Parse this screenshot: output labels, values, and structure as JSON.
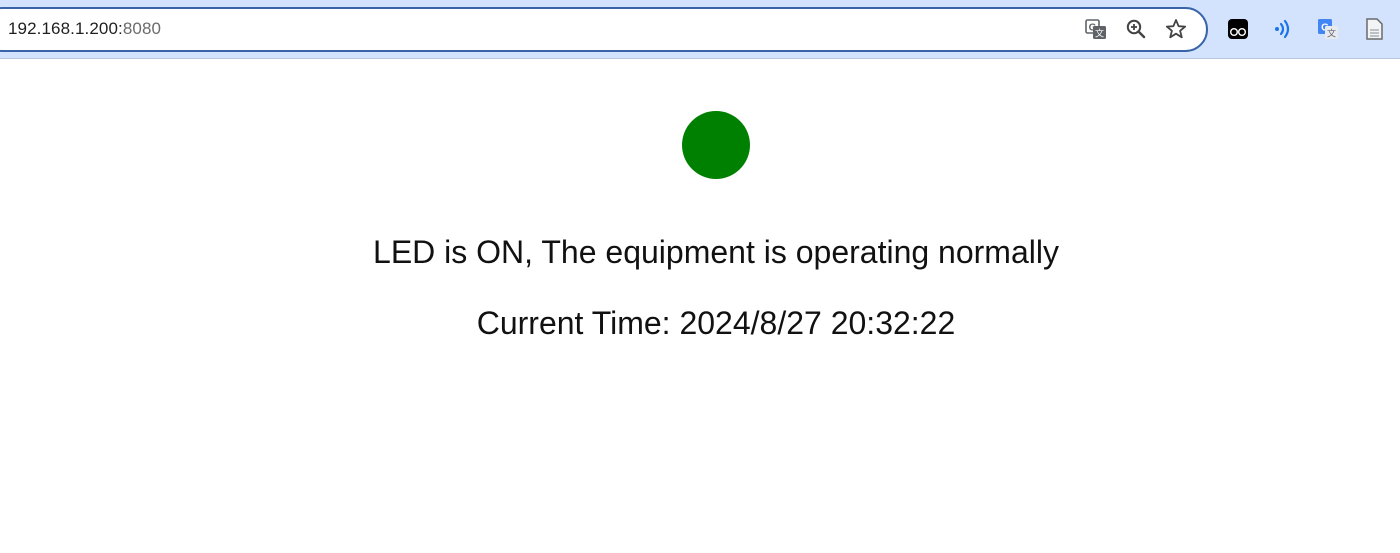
{
  "browser": {
    "address_host": "192.168.1.200:",
    "address_port": "8080",
    "omnibox_icons": [
      "translate-icon",
      "zoom-icon",
      "bookmark-star-icon"
    ],
    "extension_icons": [
      "tampermonkey-icon",
      "read-aloud-icon",
      "google-translate-icon",
      "document-icon"
    ]
  },
  "page": {
    "led_color": "#008000",
    "status_message": "LED is ON, The equipment is operating normally",
    "time_label": "Current Time: 2024/8/27 20:32:22"
  }
}
